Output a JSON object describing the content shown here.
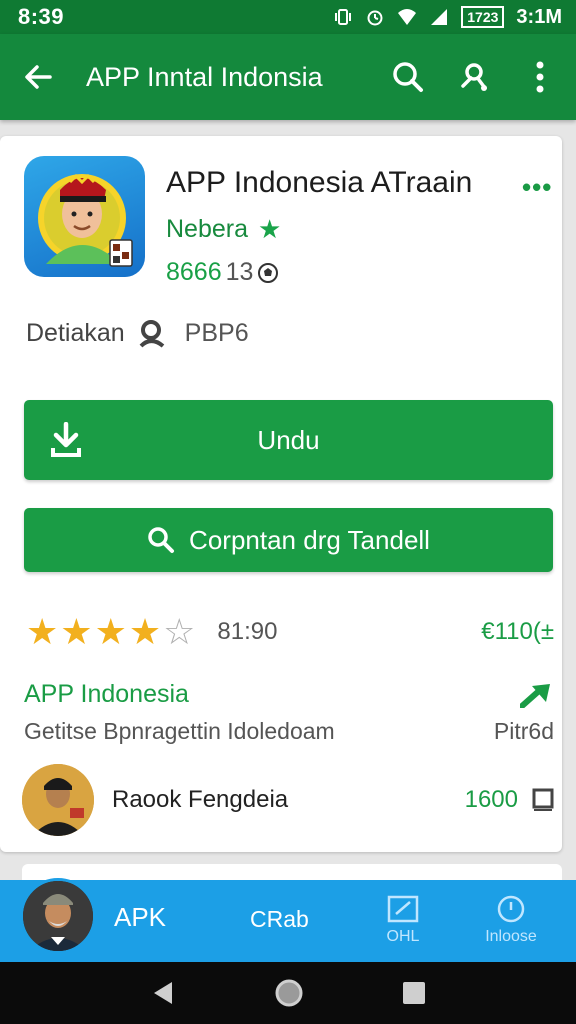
{
  "status": {
    "time": "8:39",
    "battery": "1723",
    "right_time": "3:1M"
  },
  "appbar": {
    "title": "APP Inntal Indonsia",
    "icons": [
      "back-arrow-icon",
      "search-icon",
      "share-icon",
      "more-vert-icon"
    ]
  },
  "app": {
    "name": "APP Indonesia ATraain",
    "developer": "Nebera",
    "count_green": "8666",
    "count_grey": "13",
    "detail_label": "Detiakan",
    "detail_code": "PBP6"
  },
  "buttons": {
    "download_label": "Undu",
    "search_label": "Corpntan drg Tandell"
  },
  "rating": {
    "stars": 4,
    "max_stars": 5,
    "value": "81:90",
    "right_value": "€110(±"
  },
  "section": {
    "title": "APP Indonesia",
    "description": "Getitse Bpnragettin Idoledoam",
    "side": "Pitr6d"
  },
  "reviewer": {
    "name": "Raook Fengdeia",
    "count": "1600"
  },
  "bottom_nav": {
    "apk_label": "APK",
    "crab_label": "CRab",
    "tab1_label": "OHL",
    "tab2_label": "Inloose"
  },
  "colors": {
    "primary_green": "#14893d",
    "button_green": "#1a9c45",
    "nav_blue": "#1c9fe6",
    "star_gold": "#f2b01e"
  }
}
